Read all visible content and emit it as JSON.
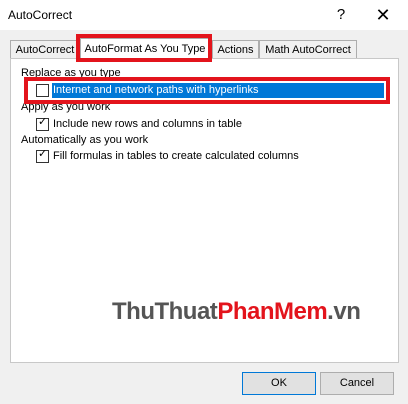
{
  "window": {
    "title": "AutoCorrect",
    "help_glyph": "?",
    "close_glyph": "✕"
  },
  "tabs": [
    {
      "label": "AutoCorrect"
    },
    {
      "label": "AutoFormat As You Type"
    },
    {
      "label": "Actions"
    },
    {
      "label": "Math AutoCorrect"
    }
  ],
  "active_tab": "AutoFormat As You Type",
  "groups": {
    "replace": {
      "label": "Replace as you type"
    },
    "apply": {
      "label": "Apply as you work"
    },
    "auto": {
      "label": "Automatically as you work"
    }
  },
  "options": {
    "hyperlinks": {
      "label": "Internet and network paths with hyperlinks",
      "checked": false
    },
    "rows_columns": {
      "label": "Include new rows and columns in table",
      "checked": true
    },
    "formulas": {
      "label": "Fill formulas in tables to create calculated columns",
      "checked": true
    }
  },
  "watermark": {
    "part1": "ThuThuat",
    "part2": "PhanMem",
    "part3": ".vn"
  },
  "buttons": {
    "ok": "OK",
    "cancel": "Cancel"
  },
  "colors": {
    "highlight": "#e3141c",
    "selection": "#0078d7",
    "watermark_dark": "#555555",
    "watermark_red": "#e3141c"
  },
  "icons": {
    "check": "✓"
  }
}
